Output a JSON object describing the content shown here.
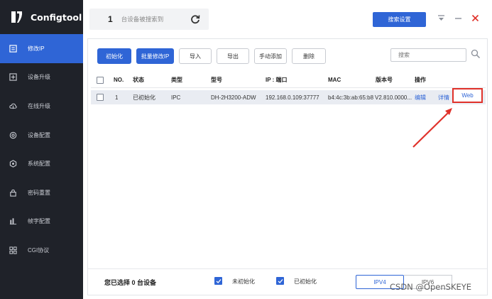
{
  "app": {
    "title": "Configtool"
  },
  "sidebar": {
    "items": [
      {
        "label": "修改IP",
        "icon": "edit-ip-icon",
        "active": true
      },
      {
        "label": "设备升级",
        "icon": "device-upgrade-icon",
        "active": false
      },
      {
        "label": "在线升级",
        "icon": "online-upgrade-icon",
        "active": false
      },
      {
        "label": "设备配置",
        "icon": "device-config-icon",
        "active": false
      },
      {
        "label": "系统配置",
        "icon": "system-config-icon",
        "active": false
      },
      {
        "label": "密码重置",
        "icon": "password-reset-icon",
        "active": false
      },
      {
        "label": "帧字配置",
        "icon": "frame-config-icon",
        "active": false
      },
      {
        "label": "CGI协议",
        "icon": "cgi-protocol-icon",
        "active": false
      }
    ]
  },
  "topbar": {
    "device_count": "1",
    "device_count_text": "台设备被搜索到",
    "search_settings_label": "搜索设置"
  },
  "toolbar": {
    "init_label": "初始化",
    "batch_edit_ip_label": "批量修改IP",
    "import_label": "导入",
    "export_label": "导出",
    "manual_add_label": "手动添加",
    "delete_label": "删除",
    "search_placeholder": "搜索"
  },
  "table": {
    "headers": {
      "no": "NO.",
      "status": "状态",
      "type": "类型",
      "model": "型号",
      "ip_port": "IP : 端口",
      "mac": "MAC",
      "version": "版本号",
      "action": "操作"
    },
    "rows": [
      {
        "no": "1",
        "status": "已初始化",
        "type": "IPC",
        "model": "DH-2H3200-ADW",
        "ip_port": "192.168.0.109:37777",
        "mac": "b4:4c:3b:ab:65:b8",
        "version": "V2.810.0000...",
        "edit": "编辑",
        "detail": "详情",
        "web": "Web"
      }
    ]
  },
  "footer": {
    "selected_text": "您已选择 0 台设备",
    "uninitialized_label": "未初始化",
    "initialized_label": "已初始化",
    "ipv4_label": "IPV4",
    "ipv6_label": "IPV6"
  },
  "watermark": "CSDN @OpenSKEYE",
  "colors": {
    "accent": "#2f65d6",
    "sidebar_bg": "#1f2229",
    "highlight_red": "#e0312a"
  }
}
